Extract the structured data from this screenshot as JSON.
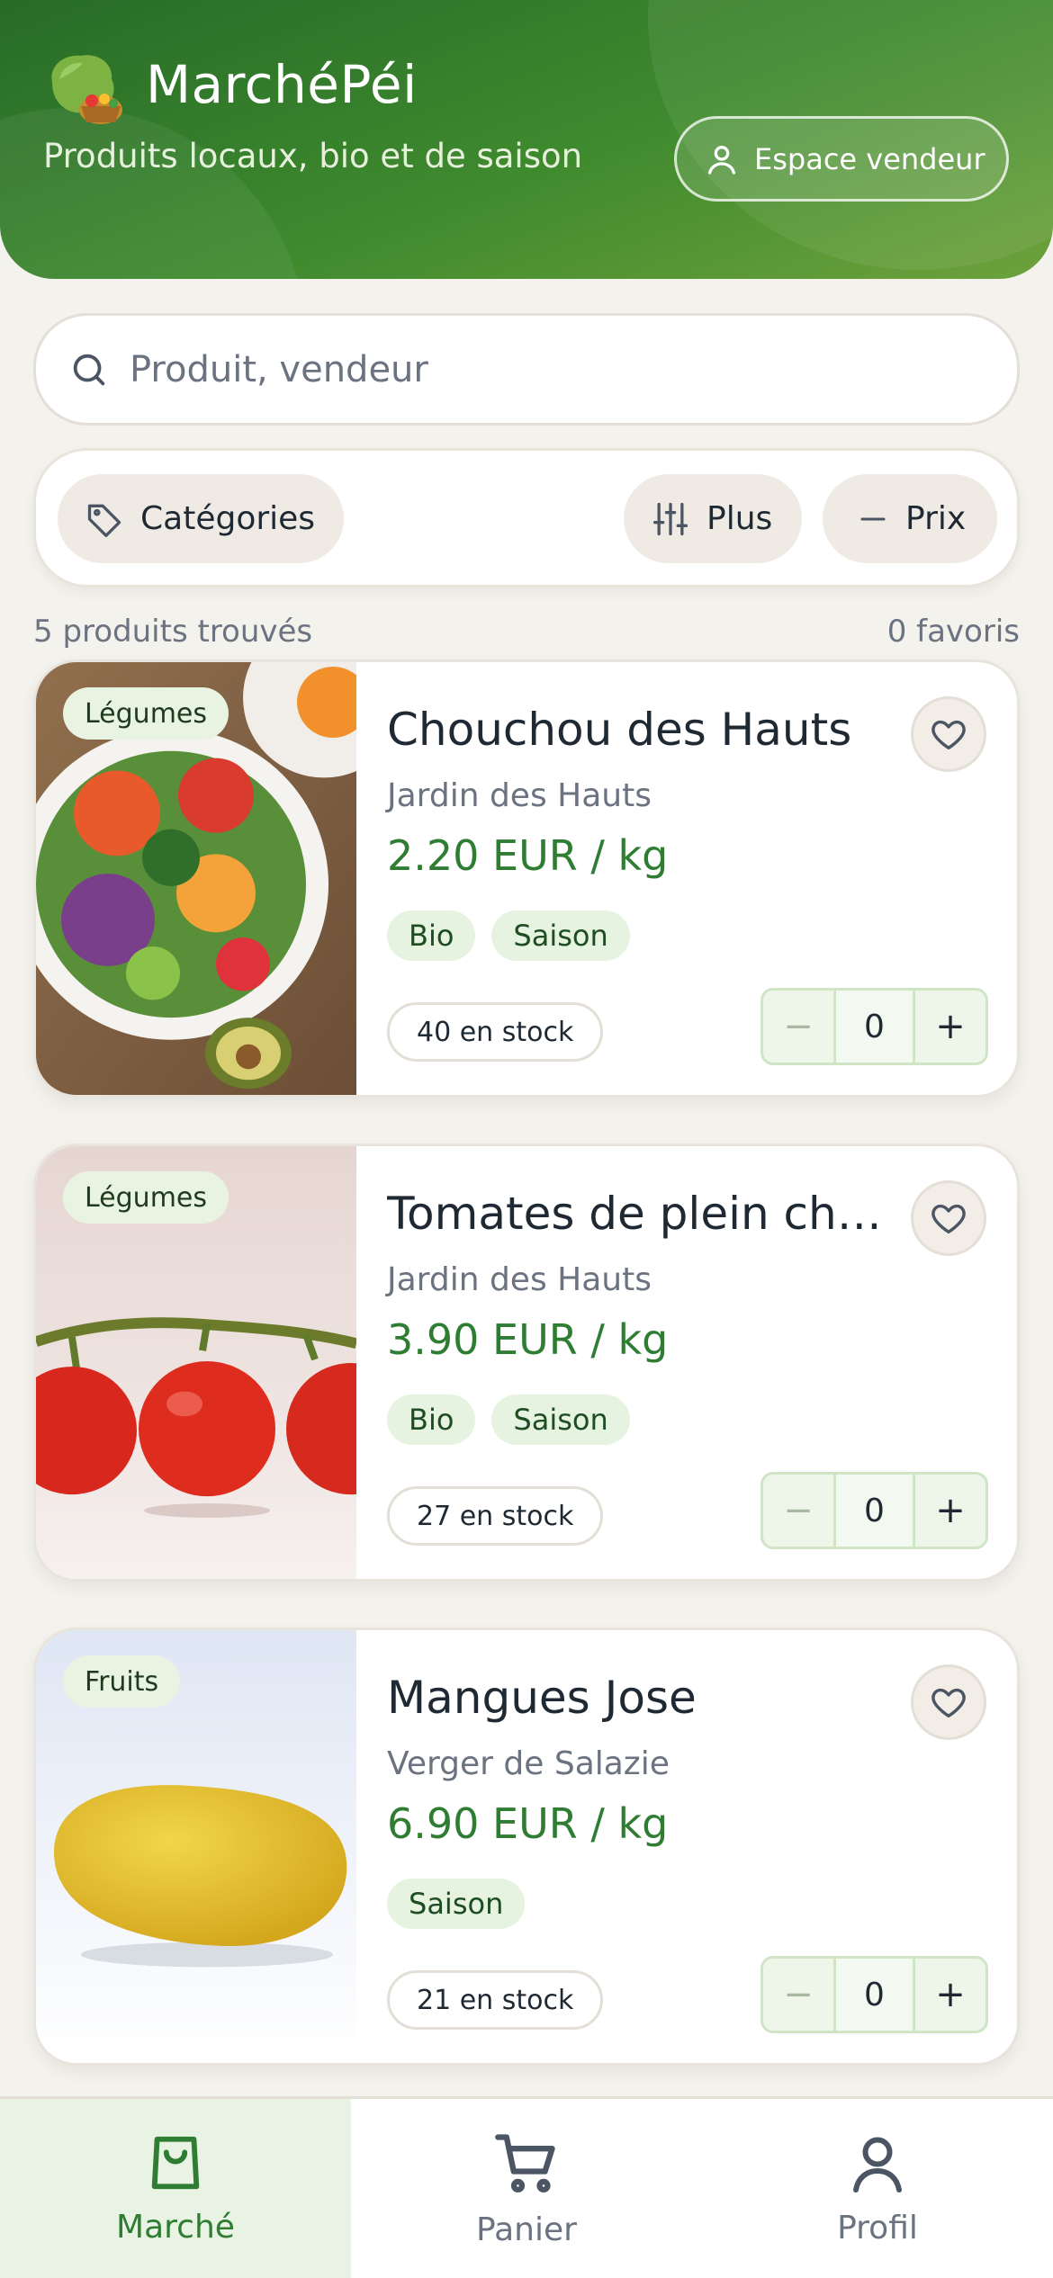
{
  "header": {
    "title": "MarchéPéi",
    "tagline": "Produits locaux, bio et de saison",
    "vendor_button": "Espace vendeur"
  },
  "search": {
    "placeholder": "Produit, vendeur",
    "value": ""
  },
  "filters": {
    "categories": "Catégories",
    "more": "Plus",
    "price": "Prix"
  },
  "summary": {
    "results": "5 produits trouvés",
    "favorites": "0 favoris"
  },
  "products": [
    {
      "category": "Légumes",
      "name": "Chouchou des Hauts",
      "vendor": "Jardin des Hauts",
      "price": "2.20 EUR / kg",
      "tags": [
        "Bio",
        "Saison"
      ],
      "stock": "40 en stock",
      "quantity": "0"
    },
    {
      "category": "Légumes",
      "name": "Tomates de plein champ",
      "vendor": "Jardin des Hauts",
      "price": "3.90 EUR / kg",
      "tags": [
        "Bio",
        "Saison"
      ],
      "stock": "27 en stock",
      "quantity": "0"
    },
    {
      "category": "Fruits",
      "name": "Mangues Jose",
      "vendor": "Verger de Salazie",
      "price": "6.90 EUR / kg",
      "tags": [
        "Saison"
      ],
      "stock": "21 en stock",
      "quantity": "0"
    }
  ],
  "stepper": {
    "minus": "−",
    "plus": "+"
  },
  "nav": [
    {
      "label": "Marché",
      "icon": "bag-icon",
      "active": true
    },
    {
      "label": "Panier",
      "icon": "cart-icon",
      "active": false
    },
    {
      "label": "Profil",
      "icon": "user-icon",
      "active": false
    }
  ],
  "colors": {
    "primary": "#2e7d32",
    "header_dark": "#276b28",
    "background": "#f4f2ed"
  }
}
